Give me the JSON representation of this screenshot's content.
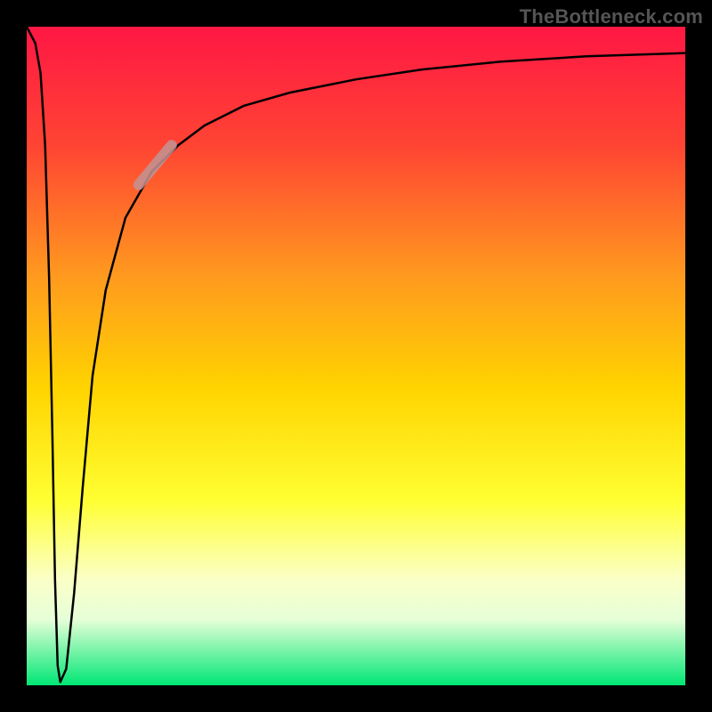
{
  "watermark": "TheBottleneck.com",
  "chart_data": {
    "type": "line",
    "title": "",
    "xlabel": "",
    "ylabel": "",
    "xlim": [
      0,
      100
    ],
    "ylim": [
      0,
      100
    ],
    "grid": false,
    "legend": false,
    "gradient_stops": [
      {
        "offset": 0.0,
        "color": "#ff1744"
      },
      {
        "offset": 0.18,
        "color": "#ff4433"
      },
      {
        "offset": 0.38,
        "color": "#ff9a1e"
      },
      {
        "offset": 0.55,
        "color": "#ffd400"
      },
      {
        "offset": 0.72,
        "color": "#ffff33"
      },
      {
        "offset": 0.84,
        "color": "#faffc8"
      },
      {
        "offset": 0.9,
        "color": "#e6ffd8"
      },
      {
        "offset": 1.0,
        "color": "#00e775"
      }
    ],
    "series": [
      {
        "name": "bottleneck-curve",
        "x": [
          0.0,
          1.3,
          2.1,
          2.8,
          3.4,
          3.9,
          4.3,
          4.7,
          5.1,
          6.0,
          7.2,
          8.5,
          10.0,
          12.0,
          15.0,
          19.0,
          23.0,
          27.0,
          33.0,
          40.0,
          50.0,
          60.0,
          72.0,
          85.0,
          100.0
        ],
        "y": [
          100.0,
          97.5,
          93.0,
          82.0,
          62.0,
          38.0,
          16.0,
          3.0,
          0.5,
          2.5,
          14.0,
          30.0,
          47.0,
          60.0,
          71.0,
          78.0,
          82.0,
          85.0,
          88.0,
          90.0,
          92.0,
          93.5,
          94.7,
          95.5,
          96.0
        ]
      }
    ],
    "highlight_segment": {
      "series": "bottleneck-curve",
      "x1": 17.0,
      "y1": 76.0,
      "x2": 22.0,
      "y2": 82.0,
      "color": "#c29494",
      "width": 12
    }
  }
}
